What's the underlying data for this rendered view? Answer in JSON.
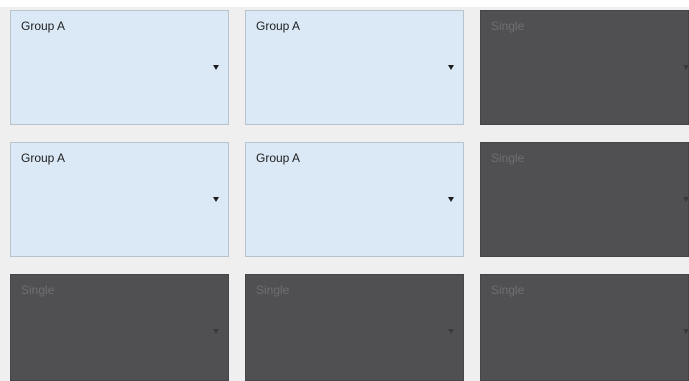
{
  "grid": {
    "cells": [
      {
        "label": "Group A",
        "style": "light"
      },
      {
        "label": "Group A",
        "style": "light"
      },
      {
        "label": "Single",
        "style": "dark"
      },
      {
        "label": "Group A",
        "style": "light"
      },
      {
        "label": "Group A",
        "style": "light"
      },
      {
        "label": "Single",
        "style": "dark"
      },
      {
        "label": "Single",
        "style": "dark"
      },
      {
        "label": "Single",
        "style": "dark"
      },
      {
        "label": "Single",
        "style": "dark"
      }
    ]
  },
  "icons": {
    "dropdown": "chevron-down-icon"
  },
  "colors": {
    "group_fill": "#dae9f5",
    "single_fill": "#505052",
    "background": "#efefef"
  }
}
